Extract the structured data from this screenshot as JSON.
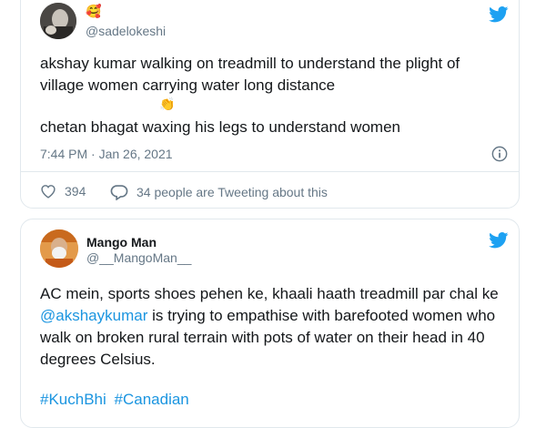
{
  "tweet1": {
    "handle": "@sadelokeshi",
    "emoji_top": "🥰",
    "text_line1": "akshay kumar walking on treadmill to understand the plight of village women carrying water long distance",
    "emoji_mid": "👏",
    "text_line2": "chetan bhagat waxing his legs to understand women",
    "timestamp": "7:44 PM · Jan 26, 2021",
    "likes": "394",
    "conversation": "34 people are Tweeting about this"
  },
  "tweet2": {
    "name": "Mango Man",
    "handle": "@__MangoMan__",
    "text_before": "AC mein, sports shoes pehen ke, khaali haath treadmill par chal ke ",
    "mention": "@akshaykumar",
    "text_after": " is trying to empathise with barefooted women who walk on broken rural terrain with pots of water on their head in 40 degrees Celsius.",
    "hashtags": [
      "#KuchBhi",
      "#Canadian"
    ]
  },
  "colors": {
    "twitter_blue": "#1da1f2",
    "link_blue": "#1b95e0",
    "muted_gray": "#657786",
    "border": "#e1e8ed",
    "like_red": "#e0245e"
  },
  "icons": {
    "bird": "twitter-bird-icon",
    "info": "info-icon",
    "heart": "heart-icon",
    "chat": "chat-bubble-icon"
  }
}
